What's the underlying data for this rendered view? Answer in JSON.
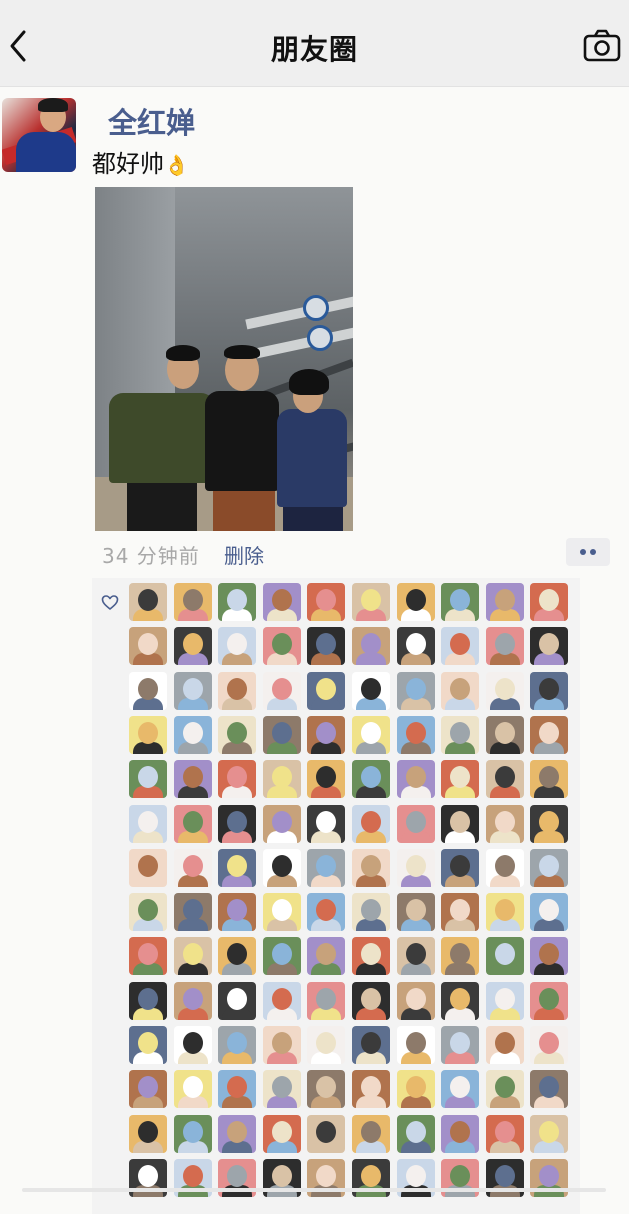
{
  "nav": {
    "title": "朋友圈",
    "back_icon": "chevron-left-icon",
    "camera_icon": "camera-icon"
  },
  "post": {
    "author": "全红婵",
    "text": "都好帅",
    "emoji": "👌",
    "time": "34 分钟前",
    "delete_label": "删除",
    "more_icon": "more-dots-icon"
  },
  "likes": {
    "heart_icon": "heart-outline-icon",
    "columns": 10,
    "rows": 14,
    "avatar_palette": [
      "#d9c2a6",
      "#3b3b3b",
      "#f1d9c8",
      "#8d7a6a",
      "#e8b96a",
      "#c9d7e8",
      "#f4f0ee",
      "#b0734d",
      "#6a8f5a",
      "#e58f8f",
      "#5d6f8f",
      "#f0e28a",
      "#a28fc9",
      "#2d2d2d",
      "#ffffff",
      "#8ab4d9",
      "#d46b4f",
      "#c7a27b",
      "#9da5ab",
      "#ede3c9"
    ]
  },
  "accent_link_color": "#4a5e8e"
}
